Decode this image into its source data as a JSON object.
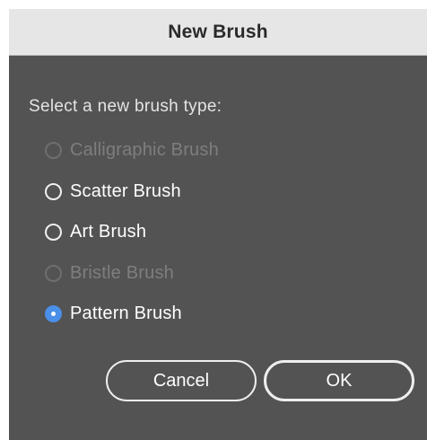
{
  "dialog": {
    "title": "New Brush",
    "prompt": "Select a new brush type:",
    "options": [
      {
        "label": "Calligraphic Brush",
        "enabled": false,
        "selected": false
      },
      {
        "label": "Scatter Brush",
        "enabled": true,
        "selected": false
      },
      {
        "label": "Art Brush",
        "enabled": true,
        "selected": false
      },
      {
        "label": "Bristle Brush",
        "enabled": false,
        "selected": false
      },
      {
        "label": "Pattern Brush",
        "enabled": true,
        "selected": true
      }
    ],
    "buttons": {
      "cancel": "Cancel",
      "ok": "OK"
    }
  },
  "colors": {
    "panel_bg": "#535353",
    "titlebar_bg": "#e6e6e6",
    "accent": "#4a8fe8",
    "disabled_text": "#7e7e7e"
  }
}
